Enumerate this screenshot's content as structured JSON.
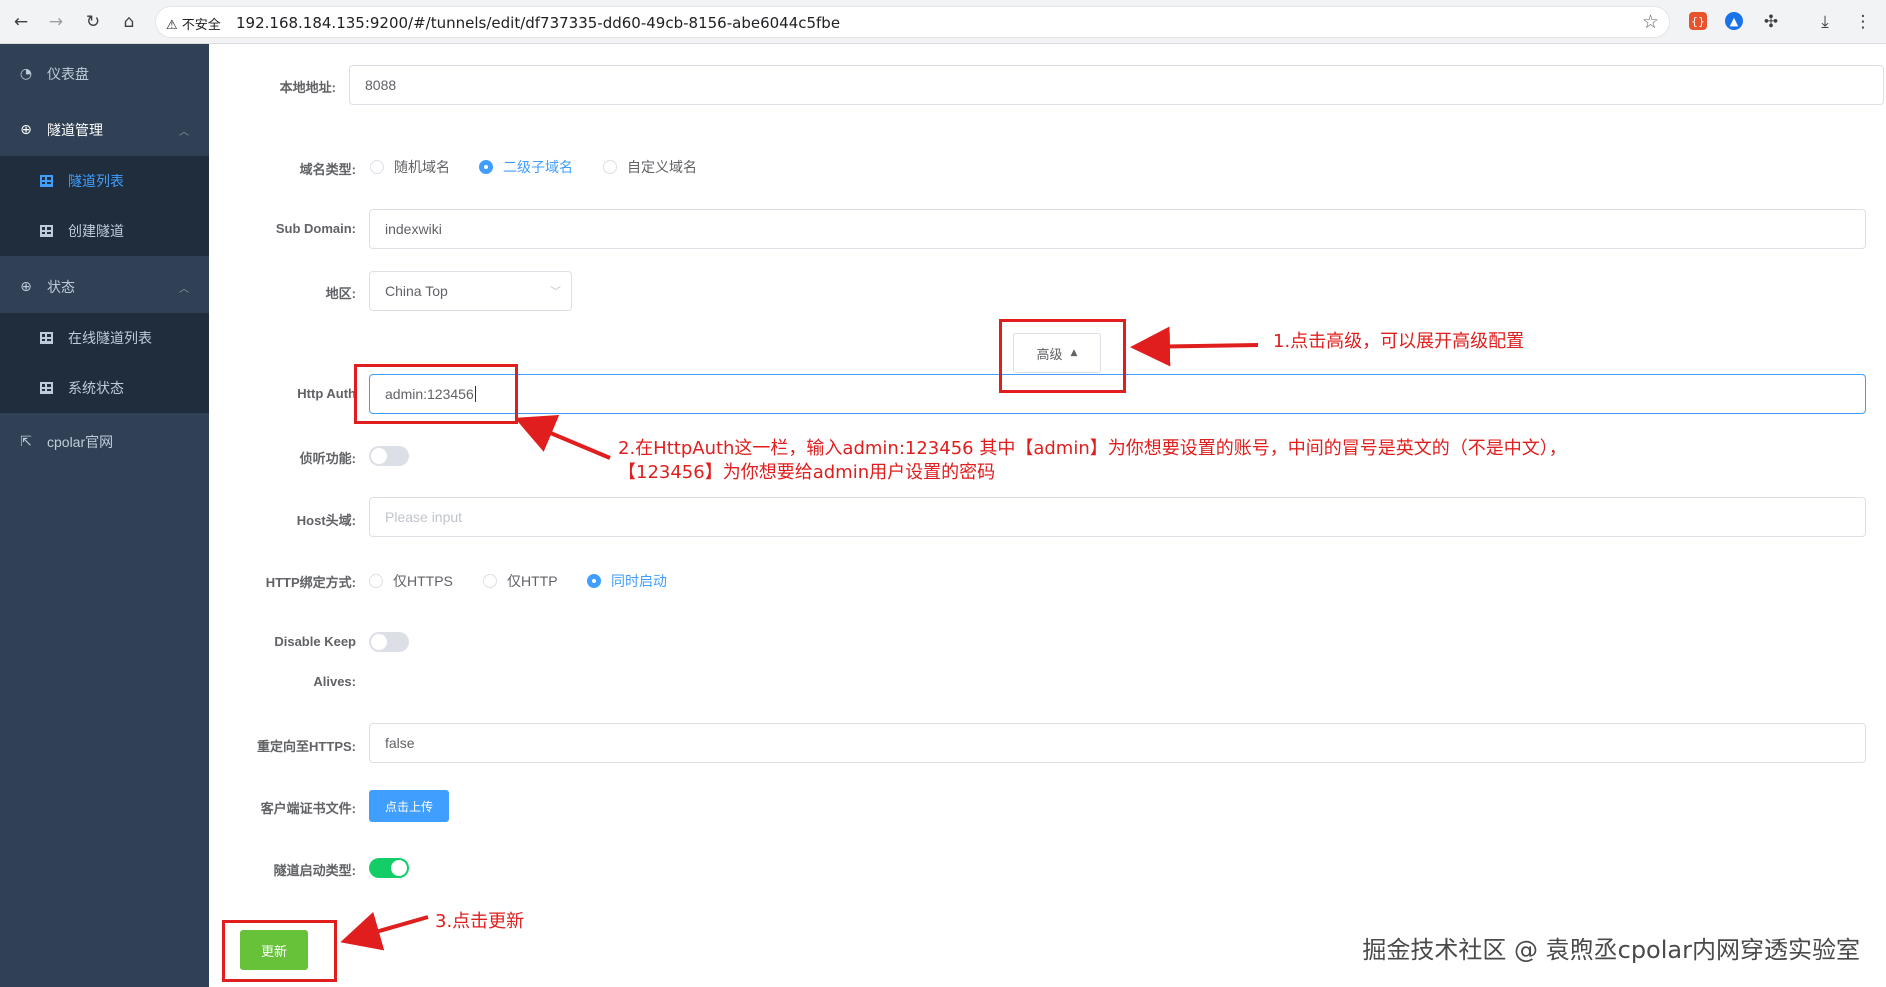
{
  "browser": {
    "insecure_label": "不安全",
    "url": "192.168.184.135:9200/#/tunnels/edit/df737335-dd60-49cb-8156-abe6044c5fbe"
  },
  "sidebar": {
    "items": [
      {
        "label": "仪表盘",
        "icon": "dashboard-icon"
      },
      {
        "label": "隧道管理",
        "icon": "plus-circle-icon"
      },
      {
        "label": "隧道列表",
        "icon": "grid-icon",
        "active": true
      },
      {
        "label": "创建隧道",
        "icon": "grid-icon"
      },
      {
        "label": "状态",
        "icon": "plus-circle-icon"
      },
      {
        "label": "在线隧道列表",
        "icon": "grid-icon"
      },
      {
        "label": "系统状态",
        "icon": "grid-icon"
      },
      {
        "label": "cpolar官网",
        "icon": "external-link-icon"
      }
    ]
  },
  "form": {
    "local_address": {
      "label": "本地地址:",
      "value": "8088"
    },
    "domain_type": {
      "label": "域名类型:",
      "options": [
        "随机域名",
        "二级子域名",
        "自定义域名"
      ],
      "selected": "二级子域名"
    },
    "sub_domain": {
      "label": "Sub Domain:",
      "value": "indexwiki"
    },
    "region": {
      "label": "地区:",
      "value": "China Top"
    },
    "advanced_button": "高级",
    "http_auth": {
      "label": "Http Auth",
      "value": "admin:123456"
    },
    "listen": {
      "label": "侦听功能:",
      "on": false
    },
    "host_header": {
      "label": "Host头域:",
      "placeholder": "Please input"
    },
    "http_bind": {
      "label": "HTTP绑定方式:",
      "options": [
        "仅HTTPS",
        "仅HTTP",
        "同时启动"
      ],
      "selected": "同时启动"
    },
    "disable_keepalives": {
      "label_line1": "Disable Keep",
      "label_line2": "Alives:",
      "on": false
    },
    "redirect_https": {
      "label": "重定向至HTTPS:",
      "value": "false"
    },
    "client_cert": {
      "label": "客户端证书文件:",
      "button": "点击上传"
    },
    "tunnel_start_type": {
      "label": "隧道启动类型:",
      "on": true
    },
    "update_button": "更新"
  },
  "annotations": {
    "note1": "1.点击高级，可以展开高级配置",
    "note2_line1": "2.在HttpAuth这一栏，输入admin:123456 其中【admin】为你想要设置的账号，中间的冒号是英文的（不是中文），",
    "note2_line2": "【123456】为你想要给admin用户设置的密码",
    "note3": "3.点击更新",
    "watermark": "掘金技术社区 @ 袁煦丞cpolar内网穿透实验室"
  },
  "colors": {
    "primary": "#409eff",
    "success": "#67c23a",
    "sidebar": "#304156",
    "annotation": "#e01e1e"
  }
}
